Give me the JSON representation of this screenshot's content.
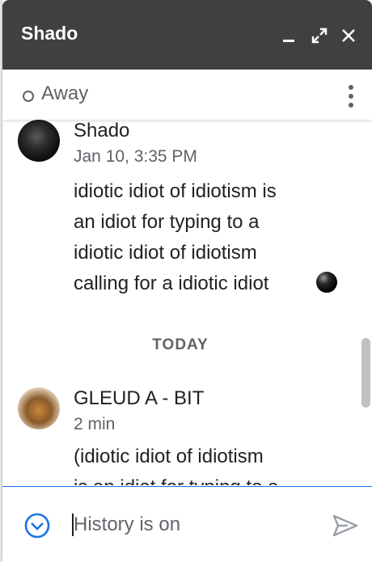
{
  "window": {
    "title": "Shado",
    "controls": [
      "minimize-icon",
      "pop-out-icon",
      "close-icon"
    ]
  },
  "status": {
    "label": "Away",
    "more_icon": "more-vertical-icon"
  },
  "messages": [
    {
      "sender": "Shado",
      "time": "Jan 10, 3:35 PM",
      "lines": [
        "idiotic idiot of idiotism is",
        "an idiot for typing to a",
        "idiotic idiot of idiotism",
        "calling for a idiotic idiot"
      ],
      "trailing_icon": "black-ball-emoji"
    },
    {
      "sender": "GLEUD A - BIT",
      "time": "2 min",
      "lines": [
        "(idiotic idiot of idiotism",
        "is an idiot for typing to a"
      ]
    }
  ],
  "divider": "TODAY",
  "composer": {
    "placeholder": "History is on",
    "expand_icon": "chevron-down-circle-icon",
    "send_icon": "send-icon"
  },
  "colors": {
    "header_bg": "#404040",
    "accent": "#1a73e8",
    "muted": "#5f6368",
    "text": "#202124"
  }
}
